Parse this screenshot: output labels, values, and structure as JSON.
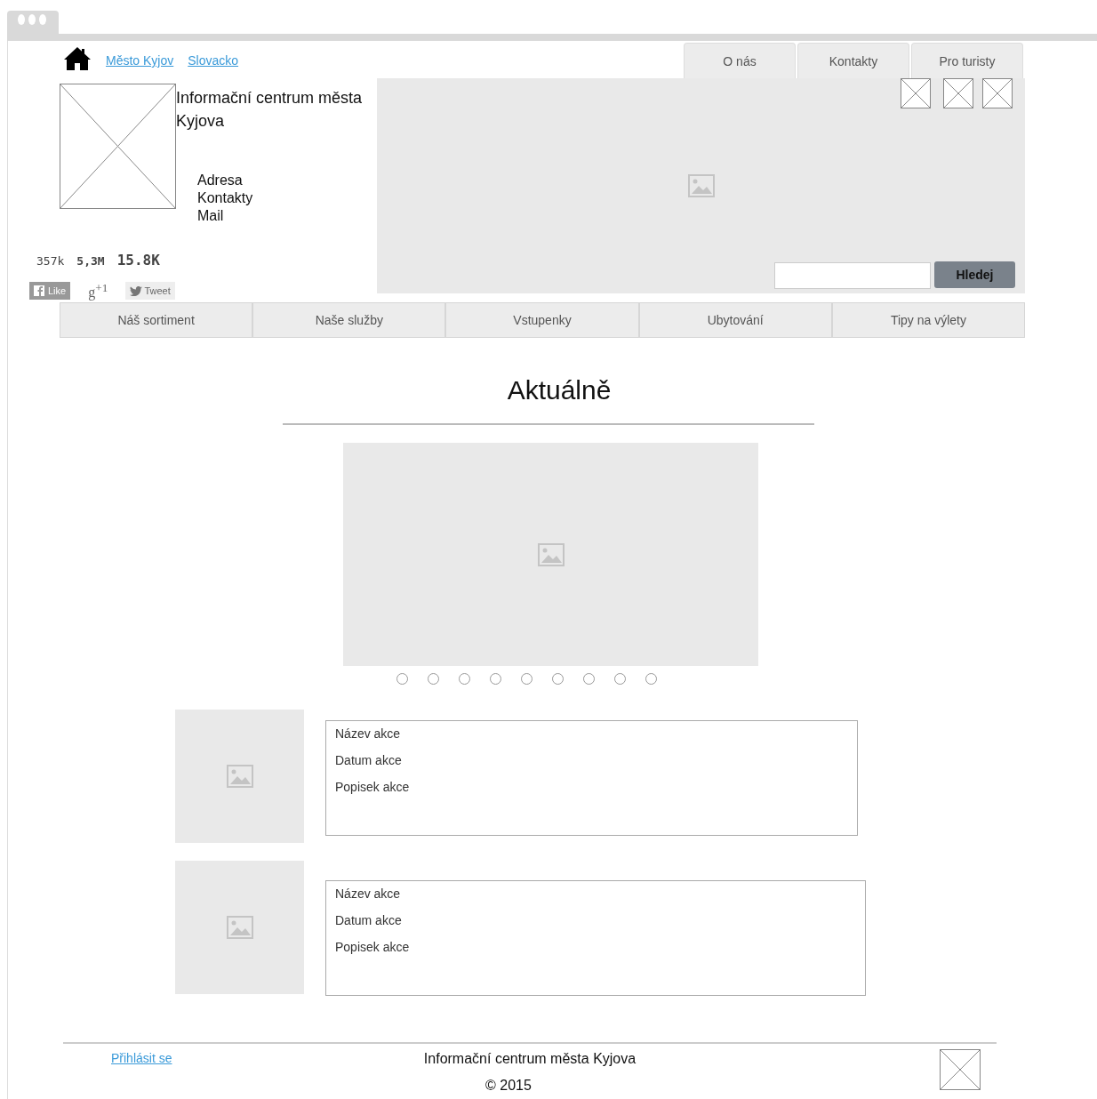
{
  "top_links": [
    {
      "label": "Město Kyjov"
    },
    {
      "label": "Slovacko"
    }
  ],
  "top_tabs": [
    {
      "label": "O nás"
    },
    {
      "label": "Kontakty"
    },
    {
      "label": "Pro turisty"
    }
  ],
  "site_title": "Informační centrum města Kyjova",
  "contact_lines": [
    "Adresa",
    "Kontakty",
    "Mail"
  ],
  "social_counts": [
    "357k",
    "5,3M",
    "15.8K"
  ],
  "social_buttons": [
    {
      "kind": "facebook",
      "label": "Like"
    },
    {
      "kind": "gplus",
      "label": "g$^{+1}$"
    },
    {
      "kind": "twitter",
      "label": "Tweet"
    }
  ],
  "search": {
    "button": "Hledej"
  },
  "nav": [
    "Náš sortiment",
    "Naše služby",
    "Vstupenky",
    "Ubytování",
    "Tipy na výlety"
  ],
  "section_title": "Aktuálně",
  "slider_dots": [
    {
      "selected": false
    },
    {
      "selected": false
    },
    {
      "selected": false
    },
    {
      "selected": false
    },
    {
      "selected": false
    },
    {
      "selected": false
    },
    {
      "selected": false
    },
    {
      "selected": false
    },
    {
      "selected": false
    }
  ],
  "events": [
    {
      "name": "Název akce",
      "date": "Datum akce",
      "description": "Popisek akce"
    },
    {
      "name": "Název akce",
      "date": "Datum akce",
      "description": "Popisek akce"
    }
  ],
  "footer": {
    "login": "Přihlásit se",
    "title": "Informační centrum města Kyjova",
    "copyright": "© 2015"
  }
}
